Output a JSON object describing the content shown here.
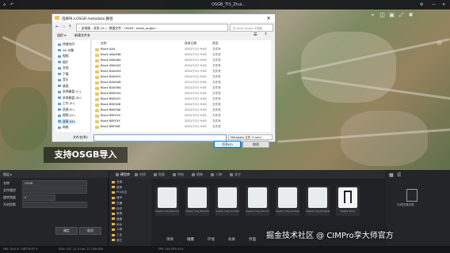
{
  "app": {
    "title": "OSGB_TIS_Zhui...",
    "top_left_icons": [
      "home-icon",
      "back-icon"
    ],
    "top_right": {
      "gear": "⚙",
      "minimize": "—",
      "close": "✕"
    }
  },
  "dialog": {
    "title": "选择导入OSGB metadata 路径",
    "path": "› 此电脑 › 双采 (H:) › 数据文件 › OSGB › tenta_angba ›",
    "search_placeholder": "在 tenta_angba 中搜索",
    "toolbar": {
      "organize": "组织 ▾",
      "new_folder": "新建文件夹"
    },
    "nav": [
      {
        "label": "快速访问"
      },
      {
        "label": "3D 对象"
      },
      {
        "label": "视频"
      },
      {
        "label": "图片"
      },
      {
        "label": "文档"
      },
      {
        "label": "下载"
      },
      {
        "label": "音乐"
      },
      {
        "label": "桌面"
      },
      {
        "label": "本地磁盘 (C:)"
      },
      {
        "label": "本地磁盘 (D:)"
      },
      {
        "label": "工作 (E:)"
      },
      {
        "label": "资源 (F:)"
      },
      {
        "label": "视频 (G:)"
      },
      {
        "label": "双采 (H:)"
      },
      {
        "label": "网络"
      }
    ],
    "columns": {
      "name": "名称",
      "date": "修改日期",
      "type": "类型"
    },
    "files": [
      {
        "name": "Block AAA",
        "date": "2021/7/11 9:45",
        "type": "文件夹"
      },
      {
        "name": "Block ABAXAB",
        "date": "2021/7/11 9:45",
        "type": "文件夹"
      },
      {
        "name": "Block ABAXBA",
        "date": "2021/7/11 9:45",
        "type": "文件夹"
      },
      {
        "name": "Block ABAXXX",
        "date": "2021/7/11 9:45",
        "type": "文件夹"
      },
      {
        "name": "Block BAAXXX",
        "date": "2021/7/11 9:45",
        "type": "文件夹"
      },
      {
        "name": "Block BAAXYX",
        "date": "2021/7/11 9:45",
        "type": "文件夹"
      },
      {
        "name": "Block BAXXAB",
        "date": "2021/7/11 9:45",
        "type": "文件夹"
      },
      {
        "name": "Block BAXXBA",
        "date": "2021/7/11 9:45",
        "type": "文件夹"
      },
      {
        "name": "Block BBXXXX",
        "date": "2021/7/11 9:45",
        "type": "文件夹"
      },
      {
        "name": "Block BBXXXY",
        "date": "2021/7/11 9:45",
        "type": "文件夹"
      },
      {
        "name": "Block BBXYAB",
        "date": "2021/7/11 9:45",
        "type": "文件夹"
      },
      {
        "name": "Block BBXYBA",
        "date": "2021/7/11 9:45",
        "type": "文件夹"
      },
      {
        "name": "Block BBYYXX",
        "date": "2021/7/11 9:45",
        "type": "文件夹"
      },
      {
        "name": "Block BBYYXY",
        "date": "2021/7/11 9:45",
        "type": "文件夹"
      },
      {
        "name": "Block BBYYAB",
        "date": "2021/7/11 9:45",
        "type": "文件夹"
      }
    ],
    "filename_label": "文件名(N):",
    "filename_value": "",
    "filter": "Metadata 文件 (*.xml)",
    "open_button": "打开(O)",
    "cancel_button": "取消"
  },
  "subtitle": "支持OSGB导入",
  "left_panel": {
    "title": "图层 ▸",
    "rows": [
      {
        "label": "名称",
        "value": "OSGB"
      },
      {
        "label": "文件路径",
        "value": ""
      },
      {
        "label": "旋转角度",
        "value": "0"
      },
      {
        "label": "开启投影",
        "value": ""
      }
    ],
    "confirm": "确定",
    "cancel": "取消"
  },
  "assets": {
    "tabs": [
      "模型库",
      "材质",
      "贴图",
      "特效",
      "植物",
      "人物",
      "其它"
    ],
    "folders": [
      "全部",
      "楼房",
      "POI点位",
      "城市",
      "交通",
      "标识",
      "家具",
      "道路",
      "树木",
      "人物",
      "工业",
      "其它"
    ],
    "items": [
      {
        "label": "OsgbS_Cdg_Basmaisng"
      },
      {
        "label": "OsgbS_Cdg_Bomhtdsos"
      },
      {
        "label": "OsgbS_Cdg_Dnddsp"
      },
      {
        "label": "OsgbS_Cdg_Dzuc3ms"
      },
      {
        "label": "OsgbS_Cdg_Dodsdpx"
      },
      {
        "label": "OsgbS_Cdg_Bmeaqfm"
      },
      {
        "label": "OsgbS_Dnxc"
      }
    ]
  },
  "right_panel": {
    "label": "在线资源加载",
    "top_icons": [
      "grid-icon",
      "list-icon"
    ]
  },
  "bottom_tabs": [
    "项目",
    "场景",
    "环境",
    "效果",
    "界面"
  ],
  "status": {
    "left": "F60: 30.0 X: 708776.97 Y:",
    "middle": "EGO: 151 -11.0 Lon: 11.7/00.000",
    "right": "FPS: 144  GPU  41%"
  },
  "watermark": "掘金技术社区 @ CIMPro孪大师官方"
}
